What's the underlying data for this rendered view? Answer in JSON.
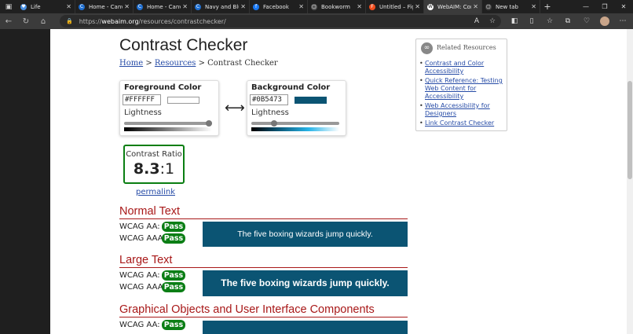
{
  "tabs": [
    {
      "label": "Life",
      "fav_color": "#4a90e2",
      "fav": "♥"
    },
    {
      "label": "Home - Canva",
      "fav_color": "#1f6fd1",
      "fav": "C"
    },
    {
      "label": "Home - Canva",
      "fav_color": "#1f6fd1",
      "fav": "C"
    },
    {
      "label": "Navy and Blue",
      "fav_color": "#1f6fd1",
      "fav": "C"
    },
    {
      "label": "Facebook",
      "fav_color": "#1877f2",
      "fav": "f"
    },
    {
      "label": "Bookworm",
      "fav_color": "#555555",
      "fav": "▢"
    },
    {
      "label": "Untitled – Figm",
      "fav_color": "#f24e1e",
      "fav": "F"
    },
    {
      "label": "WebAIM: Cont",
      "fav_color": "#ffffff",
      "fav": "W"
    },
    {
      "label": "New tab",
      "fav_color": "#444444",
      "fav": "▢"
    }
  ],
  "url": {
    "prefix": "https://",
    "host": "webaim.org",
    "path": "/resources/contrastchecker/"
  },
  "page": {
    "title": "Contrast Checker",
    "breadcrumb": {
      "home": "Home",
      "sep": " > ",
      "resources": "Resources",
      "current": "Contrast Checker"
    },
    "foreground": {
      "label": "Foreground Color",
      "hex": "#FFFFFF",
      "swatch": "#FFFFFF",
      "lightness_label": "Lightness",
      "lightness": 1.0
    },
    "background": {
      "label": "Background Color",
      "hex": "#0B5473",
      "swatch": "#0B5473",
      "lightness_label": "Lightness",
      "lightness": 0.24
    },
    "swap_glyph": "⟷",
    "ratio": {
      "title": "Contrast Ratio",
      "value": "8.3",
      "suffix": ":1"
    },
    "permalink": "permalink",
    "sections": {
      "normal": {
        "title": "Normal Text",
        "aa": "WCAG AA:",
        "aaa": "WCAG AAA:",
        "aa_result": "Pass",
        "aaa_result": "Pass",
        "sample": "The five boxing wizards jump quickly."
      },
      "large": {
        "title": "Large Text",
        "aa": "WCAG AA:",
        "aaa": "WCAG AAA:",
        "aa_result": "Pass",
        "aaa_result": "Pass",
        "sample": "The five boxing wizards jump quickly."
      },
      "graphical": {
        "title": "Graphical Objects and User Interface Components",
        "aa": "WCAG AA:",
        "aa_result": "Pass",
        "sample": "✓"
      }
    },
    "related": {
      "title": "Related Resources",
      "links": [
        "Contrast and Color Accessibility",
        "Quick Reference: Testing Web Content for Accessibility",
        "Web Accessibility for Designers",
        "Link Contrast Checker"
      ]
    }
  },
  "colors": {
    "pass": "#0B7E15",
    "heading": "#A81818",
    "link": "#264BA6"
  }
}
